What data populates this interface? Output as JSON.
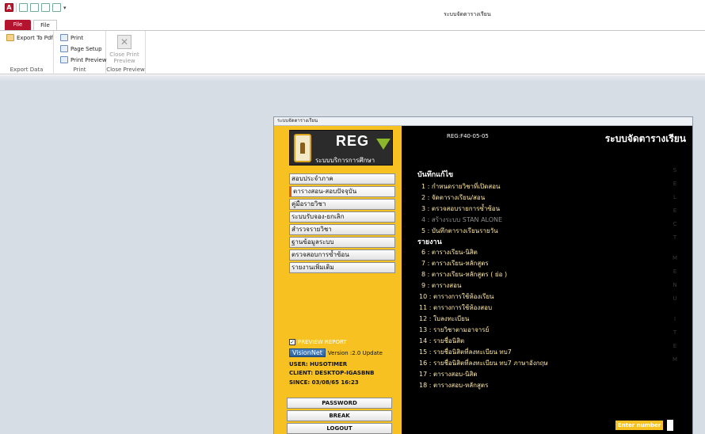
{
  "window": {
    "title": "ระบบจัดตารางเรียน"
  },
  "ribbon": {
    "tabs": [
      "File",
      "File"
    ],
    "groups": [
      {
        "label": "Export Data",
        "buttons": [
          {
            "label": "Export To Pdf",
            "icon": "pdf-export-icon"
          }
        ]
      },
      {
        "label": "Print",
        "buttons": [
          {
            "label": "Print",
            "icon": "printer-icon"
          },
          {
            "label": "Page Setup",
            "icon": "page-setup-icon"
          },
          {
            "label": "Print Preview",
            "icon": "print-preview-icon"
          }
        ]
      },
      {
        "label": "Close Preview",
        "buttons": [
          {
            "label": "Close Print Preview",
            "line1": "Close Print",
            "line2": "Preview",
            "icon": "close-icon",
            "disabled": true
          }
        ]
      }
    ]
  },
  "form": {
    "title": "ระบบจัดตารางเรียน",
    "logo": {
      "text": "REG",
      "subtitle": "ระบบบริการการศึกษา"
    },
    "menu": [
      {
        "label": "สอบประจำภาค",
        "active": false
      },
      {
        "label": "ตารางสอน-สอบปัจจุบัน",
        "active": true
      },
      {
        "label": "คู่มือรายวิชา",
        "active": false
      },
      {
        "label": "ระบบรับจอง-ยกเลิก",
        "active": false
      },
      {
        "label": "สำรวจรายวิชา",
        "active": false
      },
      {
        "label": "ฐานข้อมูลระบบ",
        "active": false
      },
      {
        "label": "ตรวจสอบการซ้ำซ้อน",
        "active": false
      },
      {
        "label": "รายงานเพิ่มเติม",
        "active": false
      }
    ],
    "preview_report": {
      "label": "PREVIEW REPORT",
      "checked": true
    },
    "visionnet": {
      "badge": "VisionNet",
      "version": "Version :2.0 Update"
    },
    "user": "USER: HUSOTIMER",
    "client": "CLIENT: DESKTOP-IGASBNB",
    "since": "SINCE: 03/08/65 16:23",
    "buttons": {
      "password": "PASSWORD",
      "break": "BREAK",
      "logout": "LOGOUT"
    },
    "code": "REG:F40-05-05",
    "heading": "ระบบจัดตารางเรียน",
    "sections": {
      "edit": "บันทึกแก้ไข",
      "report": "รายงาน"
    },
    "edit_items": [
      {
        "label": "1 : กำหนดรายวิชาที่เปิดสอน",
        "dim": false
      },
      {
        "label": "2 : จัดตารางเรียน/สอน",
        "dim": false
      },
      {
        "label": "3 : ตรวจสอบรายการซ้ำซ้อน",
        "dim": false
      },
      {
        "label": "4 : สร้างระบบ STAN ALONE",
        "dim": true
      },
      {
        "label": "5 : บันทึกตารางเรียนรายวัน",
        "dim": false
      }
    ],
    "report_items": [
      "6 : ตารางเรียน-นิสิต",
      "7 : ตารางเรียน-หลักสูตร",
      "8 : ตารางเรียน-หลักสูตร ( ย่อ )",
      "9 : ตารางสอน",
      "10 : ตารางการใช้ห้องเรียน",
      "11 : ตารางการใช้ห้องสอบ",
      "12 : ใบลงทะเบียน",
      "13 : รายวิชาตามอาจารย์",
      "14 : รายชื่อนิสิต",
      "15 : รายชื่อนิสิตที่ลงทะเบียน ทบ7",
      "16 : รายชื่อนิสิตที่ลงทะเบียน ทบ7 ภาษาอังกฤษ",
      "17 : ตารางสอบ-นิสิต",
      "18 : ตารางสอบ-หลักสูตร"
    ],
    "vertical_letters": [
      "S",
      "E",
      "L",
      "E",
      "C",
      "T",
      "M",
      "E",
      "N",
      "U",
      "I",
      "T",
      "E",
      "M"
    ],
    "enter_number": {
      "label": "Enter number",
      "value": ""
    }
  },
  "colors": {
    "panel_yellow": "#f7c221",
    "item_text": "#ffe8a0",
    "file_tab": "#b5142f"
  }
}
